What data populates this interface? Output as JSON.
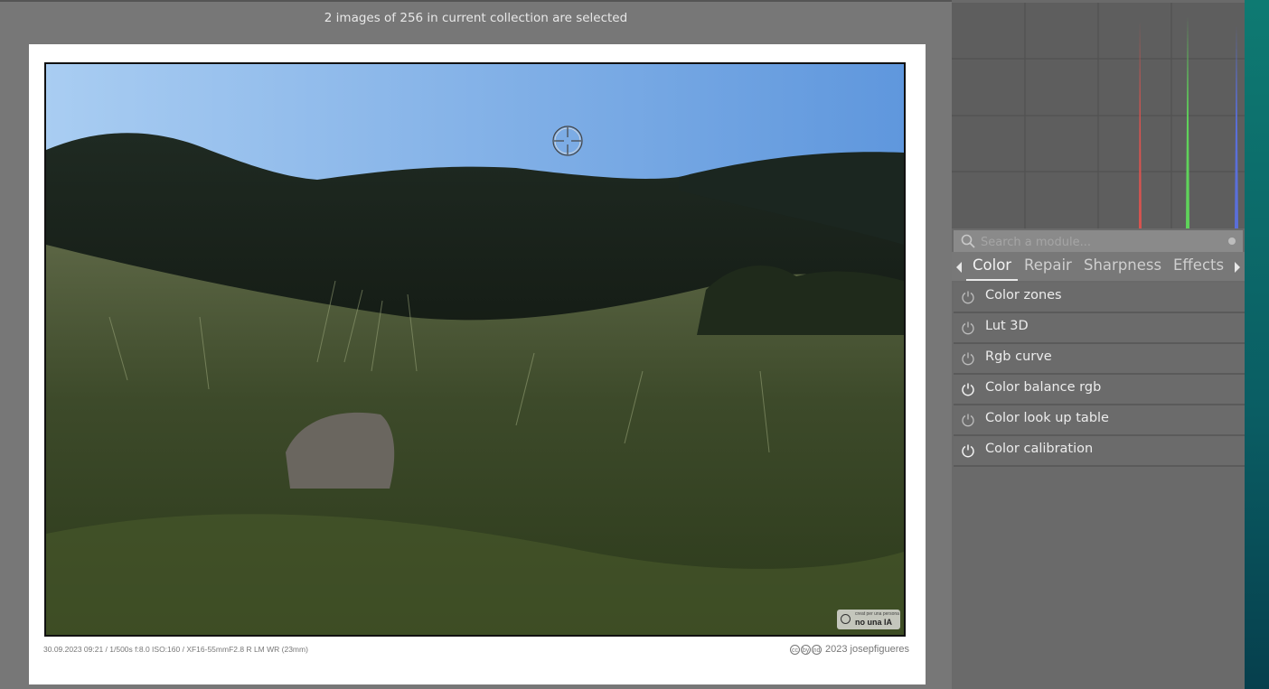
{
  "status": {
    "text": "2 images of 256 in current collection are selected"
  },
  "image": {
    "exif": "30.09.2023  09:21 / 1/500s f:8.0 ISO:160 / XF16-55mmF2.8 R LM WR (23mm)",
    "credit": "2023 josepfigueres",
    "cc_icons": [
      "cc",
      "by",
      "nd"
    ],
    "badge_small": "creat per una persona",
    "badge_big": "no una IA"
  },
  "search": {
    "placeholder": "Search a module..."
  },
  "tabs": [
    {
      "label": "Color",
      "active": true
    },
    {
      "label": "Repair",
      "active": false
    },
    {
      "label": "Sharpness",
      "active": false
    },
    {
      "label": "Effects",
      "active": false
    }
  ],
  "modules": [
    {
      "label": "Color zones",
      "enabled": false,
      "icon": "power-icon"
    },
    {
      "label": "Lut 3D",
      "enabled": false,
      "icon": "power-icon"
    },
    {
      "label": "Rgb curve",
      "enabled": false,
      "icon": "power-icon"
    },
    {
      "label": "Color balance rgb",
      "enabled": true,
      "icon": "power-icon"
    },
    {
      "label": "Color look up table",
      "enabled": false,
      "icon": "power-icon"
    },
    {
      "label": "Color calibration",
      "enabled": true,
      "icon": "power-icon"
    }
  ],
  "colors": {
    "histogram_red": "#d9534f",
    "histogram_green": "#5fd35a",
    "histogram_blue": "#5a6fd9",
    "accent_edge": "#0e7a72"
  }
}
